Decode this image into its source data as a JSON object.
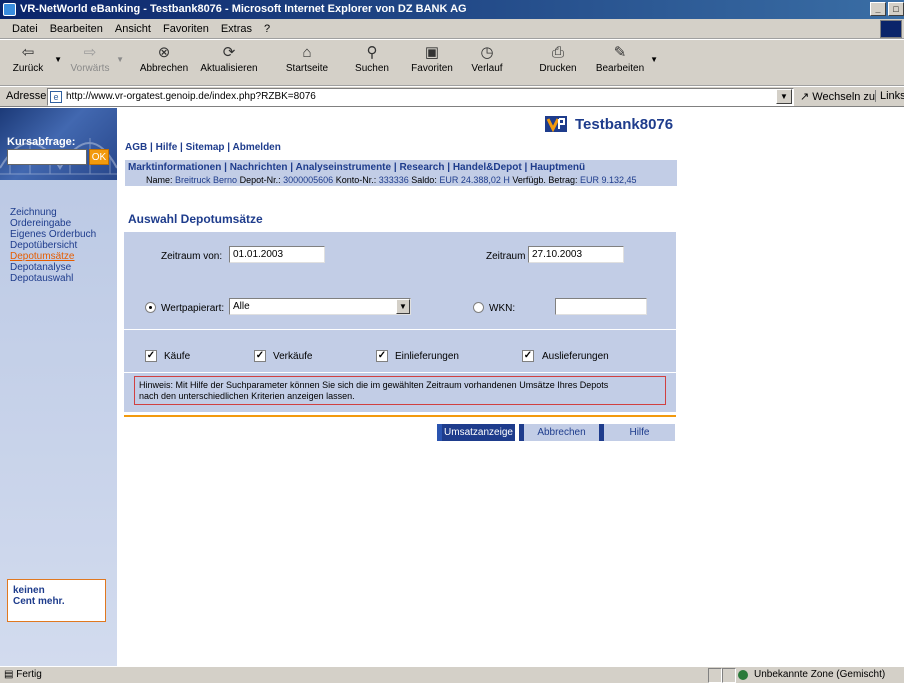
{
  "window": {
    "title": "VR-NetWorld eBanking - Testbank8076  - Microsoft Internet Explorer von DZ BANK AG",
    "controls": [
      "_",
      "□"
    ]
  },
  "menu": [
    "Datei",
    "Bearbeiten",
    "Ansicht",
    "Favoriten",
    "Extras",
    "?"
  ],
  "toolbar": {
    "back": "Zurück",
    "forward": "Vorwärts",
    "stop": "Abbrechen",
    "refresh": "Aktualisieren",
    "home": "Startseite",
    "search": "Suchen",
    "favorites": "Favoriten",
    "history": "Verlauf",
    "print": "Drucken",
    "edit": "Bearbeiten"
  },
  "address": {
    "label": "Adresse",
    "url": "http://www.vr-orgatest.genoip.de/index.php?RZBK=8076",
    "go": "Wechseln zu",
    "links": "Links"
  },
  "sidebar": {
    "quote_label": "Kursabfrage:",
    "ok": "OK",
    "items": [
      {
        "label": "Zeichnung",
        "active": false
      },
      {
        "label": "Ordereingabe",
        "active": false
      },
      {
        "label": "Eigenes Orderbuch",
        "active": false
      },
      {
        "label": "Depotübersicht",
        "active": false
      },
      {
        "label": "Depotumsätze",
        "active": true
      },
      {
        "label": "Depotanalyse",
        "active": false
      },
      {
        "label": "Depotauswahl",
        "active": false
      }
    ],
    "promo_line1": "keinen",
    "promo_line2": "Cent mehr."
  },
  "header": {
    "bank_name": "Testbank8076",
    "meta_links": [
      "AGB",
      "Hilfe",
      "Sitemap",
      "Abmelden"
    ],
    "nav_links": [
      "Marktinformationen",
      "Nachrichten",
      "Analyseinstrumente",
      "Research",
      "Handel&Depot",
      "Hauptmenü"
    ]
  },
  "account": {
    "name_label": "Name:",
    "name": "Breitruck Berno",
    "depot_label": "Depot-Nr.:",
    "depot": "3000005606",
    "konto_label": "Konto-Nr.:",
    "konto": "333336",
    "saldo_label": "Saldo:",
    "saldo": "EUR 24.388,02 H",
    "avail_label": "Verfügb. Betrag:",
    "avail": "EUR 9.132,45"
  },
  "form": {
    "title": "Auswahl Depotumsätze",
    "from_label": "Zeitraum von:",
    "from_value": "01.01.2003",
    "to_label": "Zeitraum bis:",
    "to_value": "27.10.2003",
    "wp_label": "Wertpapierart:",
    "wp_value": "Alle",
    "wkn_label": "WKN:",
    "wkn_value": "",
    "checkboxes": [
      {
        "label": "Käufe",
        "checked": true
      },
      {
        "label": "Verkäufe",
        "checked": true
      },
      {
        "label": "Einlieferungen",
        "checked": true
      },
      {
        "label": "Auslieferungen",
        "checked": true
      }
    ],
    "hint_line1": "Hinweis: Mit Hilfe der Suchparameter können Sie sich die im gewählten Zeitraum vorhandenen Umsätze Ihres Depots",
    "hint_line2": "nach den unterschiedlichen Kriterien anzeigen lassen."
  },
  "buttons": {
    "show": "Umsatzanzeige",
    "cancel": "Abbrechen",
    "help": "Hilfe"
  },
  "status": {
    "text": "Fertig",
    "zone": "Unbekannte Zone (Gemischt)"
  },
  "colors": {
    "accent_blue": "#1e3c8c",
    "panel": "#c2cde6",
    "orange": "#f29a0e"
  }
}
